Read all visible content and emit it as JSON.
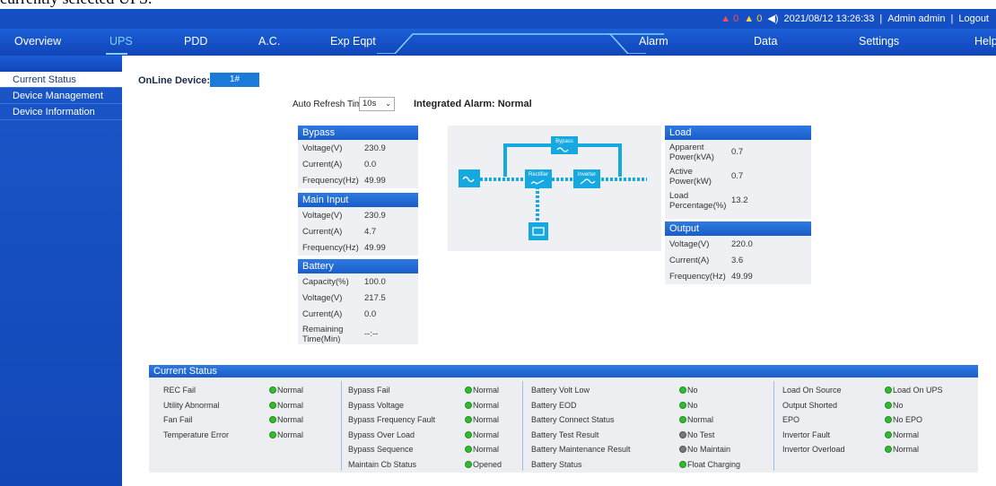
{
  "caption": "currently selected UPS.",
  "topbar": {
    "alarm_red_count": "0",
    "alarm_yellow_count": "0",
    "datetime": "2021/08/12 13:26:33",
    "user": "Admin admin",
    "logout": "Logout"
  },
  "nav": {
    "overview": "Overview",
    "ups": "UPS",
    "pdd": "PDD",
    "ac": "A.C.",
    "exp": "Exp Eqpt",
    "alarm": "Alarm",
    "data": "Data",
    "settings": "Settings",
    "help": "Help"
  },
  "sidebar": {
    "items": [
      "Current Status",
      "Device Management",
      "Device Information"
    ]
  },
  "main": {
    "online_label": "OnLine Device:",
    "online_device": "1#",
    "refresh_label": "Auto Refresh Time",
    "refresh_value": "10s",
    "integrated_alarm": "Integrated Alarm: Normal"
  },
  "bypass": {
    "title": "Bypass",
    "rows": [
      {
        "k": "Voltage(V)",
        "v": "230.9"
      },
      {
        "k": "Current(A)",
        "v": "0.0"
      },
      {
        "k": "Frequency(Hz)",
        "v": "49.99"
      }
    ]
  },
  "main_input": {
    "title": "Main Input",
    "rows": [
      {
        "k": "Voltage(V)",
        "v": "230.9"
      },
      {
        "k": "Current(A)",
        "v": "4.7"
      },
      {
        "k": "Frequency(Hz)",
        "v": "49.99"
      }
    ]
  },
  "battery": {
    "title": "Battery",
    "rows": [
      {
        "k": "Capacity(%)",
        "v": "100.0"
      },
      {
        "k": "Voltage(V)",
        "v": "217.5"
      },
      {
        "k": "Current(A)",
        "v": "0.0"
      },
      {
        "k": "Remaining Time(Min)",
        "v": "--:--"
      }
    ]
  },
  "load": {
    "title": "Load",
    "rows": [
      {
        "k": "Apparent Power(kVA)",
        "v": "0.7"
      },
      {
        "k": "Active Power(kW)",
        "v": "0.7"
      },
      {
        "k": "Load Percentage(%)",
        "v": "13.2"
      }
    ]
  },
  "output": {
    "title": "Output",
    "rows": [
      {
        "k": "Voltage(V)",
        "v": "220.0"
      },
      {
        "k": "Current(A)",
        "v": "3.6"
      },
      {
        "k": "Frequency(Hz)",
        "v": "49.99"
      }
    ]
  },
  "diagram": {
    "bypass": "Bypass",
    "rectifier": "Rectifier",
    "inverter": "Inverter"
  },
  "current_status": {
    "title": "Current Status",
    "col1": [
      {
        "label": "REC Fail",
        "value": "Normal",
        "state": "green"
      },
      {
        "label": "Utility Abnormal",
        "value": "Normal",
        "state": "green"
      },
      {
        "label": "Fan Fail",
        "value": "Normal",
        "state": "green"
      },
      {
        "label": "Temperature Error",
        "value": "Normal",
        "state": "green"
      }
    ],
    "col2": [
      {
        "label": "Bypass Fail",
        "value": "Normal",
        "state": "green"
      },
      {
        "label": "Bypass Voltage",
        "value": "Normal",
        "state": "green"
      },
      {
        "label": "Bypass Frequency Fault",
        "value": "Normal",
        "state": "green"
      },
      {
        "label": "Bypass Over Load",
        "value": "Normal",
        "state": "green"
      },
      {
        "label": "Bypass Sequence",
        "value": "Normal",
        "state": "green"
      },
      {
        "label": "Maintain Cb Status",
        "value": "Opened",
        "state": "green"
      }
    ],
    "col3": [
      {
        "label": "Battery Volt Low",
        "value": "No",
        "state": "green"
      },
      {
        "label": "Battery EOD",
        "value": "No",
        "state": "green"
      },
      {
        "label": "Battery Connect Status",
        "value": "Normal",
        "state": "green"
      },
      {
        "label": "Battery Test Result",
        "value": "No Test",
        "state": "grey"
      },
      {
        "label": "Battery Maintenance Result",
        "value": "No Maintain",
        "state": "grey"
      },
      {
        "label": "Battery Status",
        "value": "Float Charging",
        "state": "green"
      }
    ],
    "col4": [
      {
        "label": "Load On Source",
        "value": "Load On UPS",
        "state": "green"
      },
      {
        "label": "Output Shorted",
        "value": "No",
        "state": "green"
      },
      {
        "label": "EPO",
        "value": "No EPO",
        "state": "green"
      },
      {
        "label": "Invertor Fault",
        "value": "Normal",
        "state": "green"
      },
      {
        "label": "Invertor Overload",
        "value": "Normal",
        "state": "green"
      }
    ]
  }
}
